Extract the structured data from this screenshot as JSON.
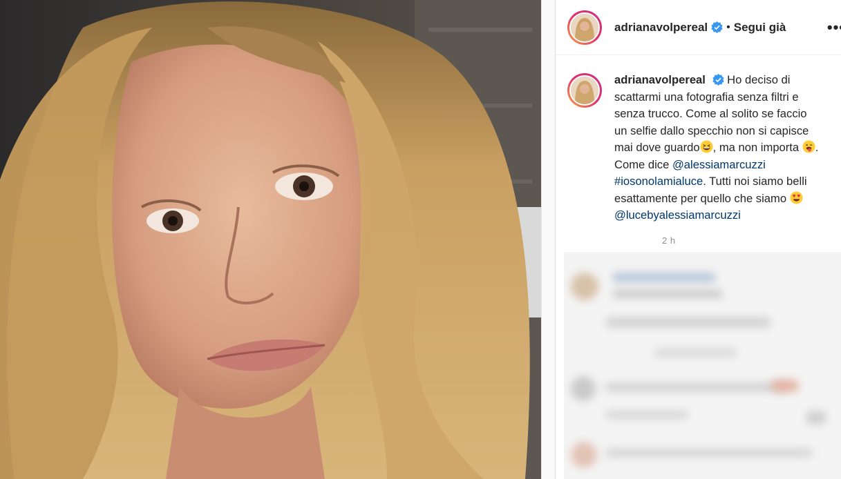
{
  "post": {
    "username": "adrianavolpereal",
    "follow_state": "Segui già",
    "separator": "•",
    "more_icon": "more-horizontal-icon",
    "caption": {
      "username": "adrianavolpereal",
      "text_1": "Ho deciso di scattarmi una fotografia senza filtri e senza trucco. Come al solito se faccio un selfie dallo specchio non si capisce mai dove guardo",
      "text_2": ", ma non importa ",
      "text_3": ". Come dice ",
      "mention_1": "@alessiamarcuzzi",
      "hashtag_1": "#iosonolamialuce",
      "text_4": ". Tutti noi siamo belli esattamente per quello che siamo ",
      "mention_2": "@lucebyalessiamarcuzzi",
      "emoji_1": "grinning-squinting-face",
      "emoji_2": "winking-face-with-tongue",
      "emoji_3": "heart-eyes-face"
    },
    "time_ago": "2 h"
  },
  "colors": {
    "verified_blue": "#3897f0",
    "link_blue": "#00376b",
    "muted_gray": "#8e8e8e",
    "story_ring": [
      "#f9a743",
      "#e1306c",
      "#c13584"
    ]
  }
}
